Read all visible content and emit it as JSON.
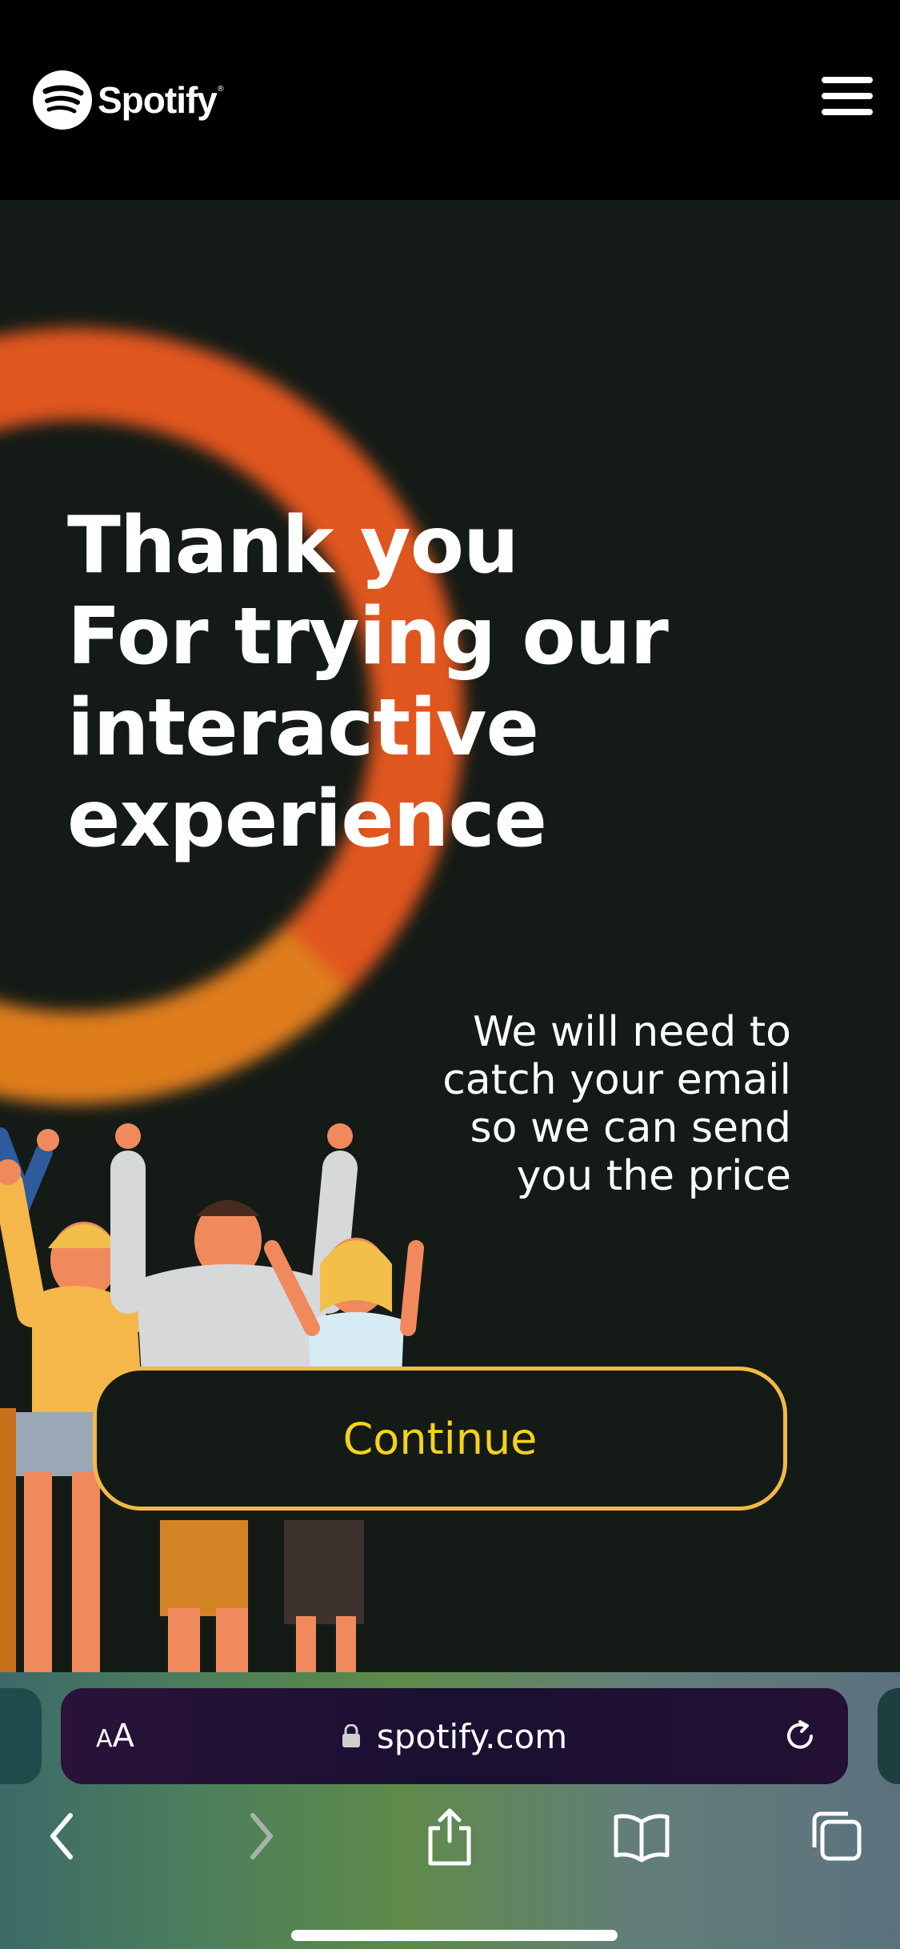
{
  "header": {
    "brand": "Spotify",
    "logo_icon": "spotify-logo-icon",
    "menu_icon": "hamburger-menu-icon"
  },
  "hero": {
    "headline_lines": [
      "Thank you",
      "For trying our",
      "interactive",
      "experience"
    ],
    "subtext_lines": [
      "We will need to",
      "catch your email",
      "so we can send",
      "you the price"
    ],
    "continue_label": "Continue"
  },
  "browser": {
    "text_size_small": "A",
    "text_size_big": "A",
    "url": "spotify.com",
    "lock_icon": "lock-icon",
    "reload_icon": "reload-icon",
    "back_icon": "back-chevron-icon",
    "forward_icon": "forward-chevron-icon",
    "share_icon": "share-icon",
    "bookmarks_icon": "bookmarks-book-icon",
    "tabs_icon": "tabs-icon"
  },
  "colors": {
    "background": "#141b16",
    "ring": "#e0561f",
    "button_border": "#f2b948",
    "button_text": "#f5d21c"
  }
}
